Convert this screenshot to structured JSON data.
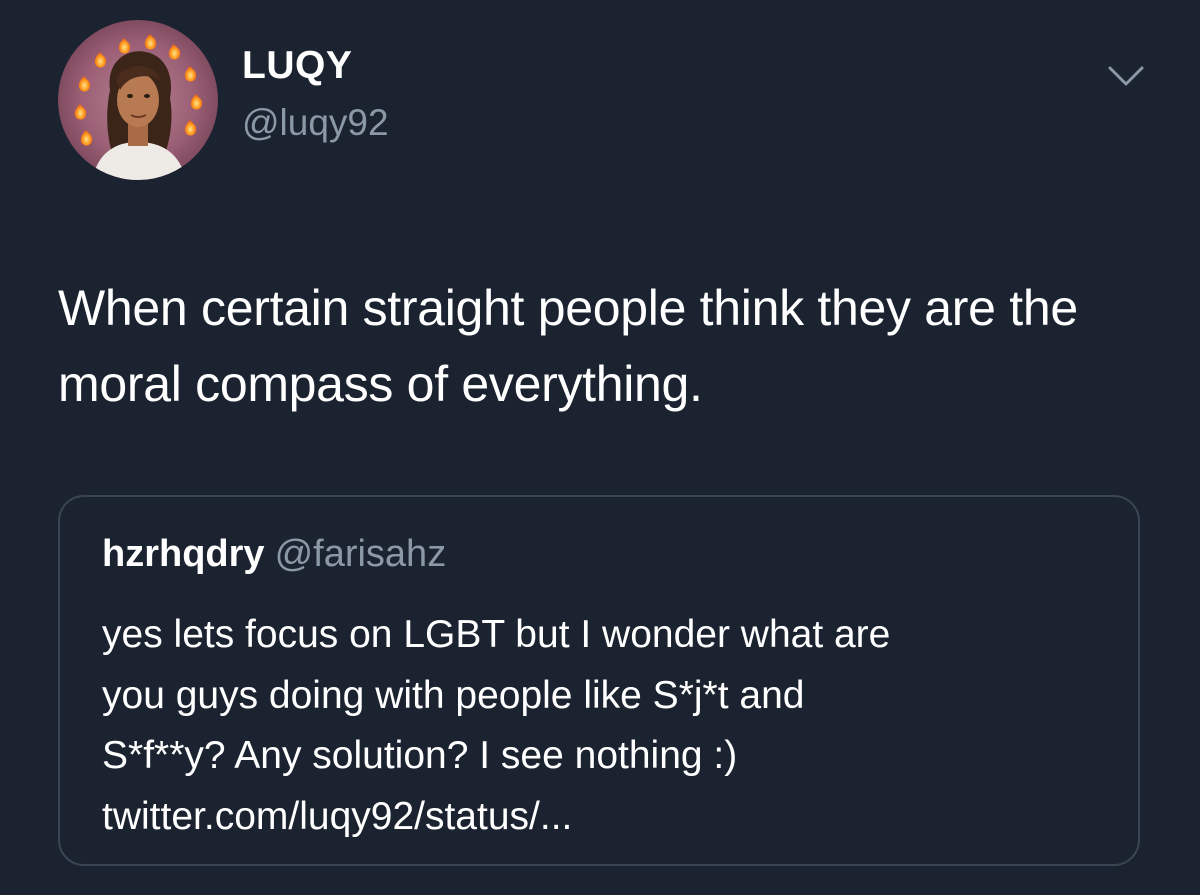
{
  "tweet": {
    "display_name": "LUQY",
    "handle": "@luqy92",
    "text": "When certain straight people think they are the moral compass of everything.",
    "avatar_icon": "profile-photo-with-fire-emoji-ring",
    "menu_icon": "chevron-down-icon"
  },
  "quoted_tweet": {
    "display_name": "hzrhqdry",
    "handle": "@farisahz",
    "lines": [
      "yes lets focus on LGBT but I wonder what are",
      "you guys doing with people like S*j*t and",
      "S*f**y? Any solution? I see nothing :)",
      "twitter.com/luqy92/status/..."
    ]
  },
  "colors": {
    "background": "#1c2330",
    "primary_text": "#ffffff",
    "secondary_text": "#8b98a5",
    "card_border": "#3a4553"
  }
}
